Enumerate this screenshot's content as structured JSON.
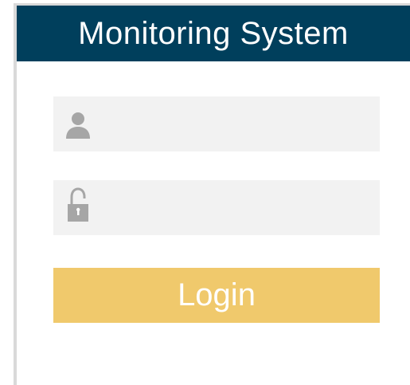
{
  "header": {
    "title": "Monitoring System"
  },
  "form": {
    "username": {
      "icon": "user-icon",
      "value": "",
      "placeholder": ""
    },
    "password": {
      "icon": "padlock-icon",
      "value": "",
      "placeholder": ""
    },
    "login_label": "Login"
  },
  "colors": {
    "header_bg": "#003f5c",
    "field_bg": "#f2f2f2",
    "button_bg": "#f0c96c",
    "icon": "#a6a6a6",
    "text_on_dark": "#ffffff"
  }
}
